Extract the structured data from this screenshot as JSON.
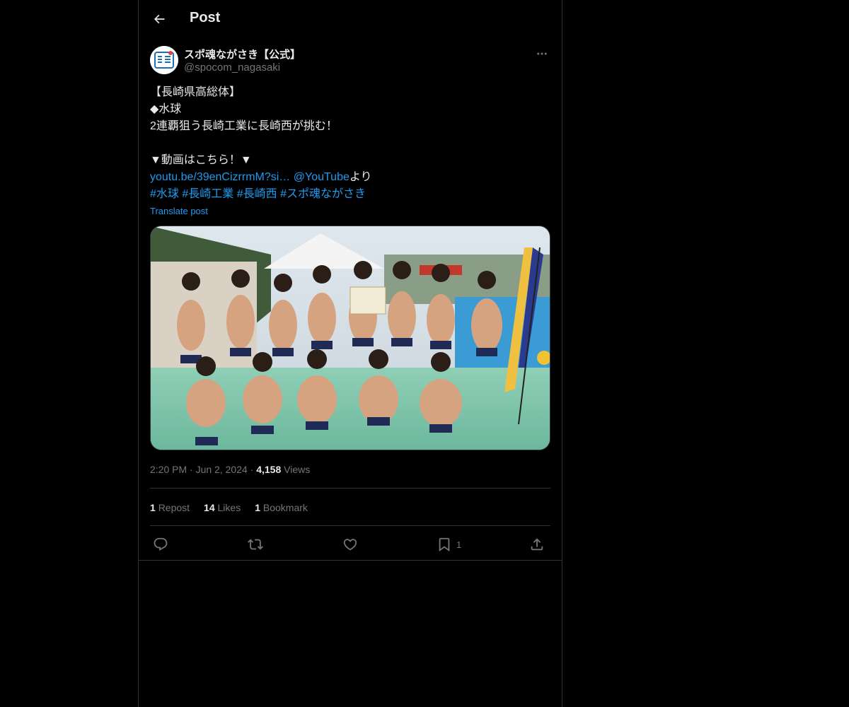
{
  "header": {
    "title": "Post",
    "back_icon": "arrow-left-icon"
  },
  "author": {
    "display_name": "スポ魂ながさき【公式】",
    "handle": "@spocom_nagasaki",
    "avatar_icon": "spocom-logo-icon",
    "more_icon": "more-horizontal-icon"
  },
  "tweet": {
    "lines": [
      "【長崎県高総体】",
      "◆水球",
      "2連覇狙う長崎工業に長崎西が挑む！",
      "",
      "▼動画はこちら！▼"
    ],
    "link_url": "youtu.be/39enCizrrmM?si…",
    "link_mention": "@YouTube",
    "link_suffix": "より",
    "hashtags": [
      "#水球",
      "#長崎工業",
      "#長崎西",
      "#スポ魂ながさき"
    ],
    "translate": "Translate post"
  },
  "meta": {
    "time": "2:20 PM",
    "date": "Jun 2, 2024",
    "views_count": "4,158",
    "views_label": "Views",
    "separator": "·"
  },
  "stats": {
    "reposts_count": "1",
    "reposts_label": "Repost",
    "likes_count": "14",
    "likes_label": "Likes",
    "bookmarks_count": "1",
    "bookmarks_label": "Bookmark"
  },
  "actions": {
    "reply_icon": "reply-icon",
    "repost_icon": "repost-icon",
    "like_icon": "heart-icon",
    "bookmark_icon": "bookmark-icon",
    "bookmark_count": "1",
    "share_icon": "share-icon"
  },
  "colors": {
    "background": "#000000",
    "text": "#e7e9ea",
    "muted": "#71767b",
    "link": "#1d9bf0",
    "border": "#2f3336"
  }
}
